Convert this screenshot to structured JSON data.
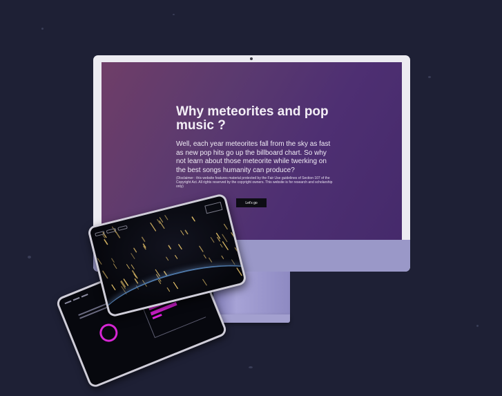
{
  "landing": {
    "title": "Why meteorites and pop music ?",
    "lead": "Well, each year meteorites fall from the sky as fast as new pop hits go up the billboard chart. So why not learn about those meteorite while twerking on the best songs humanity can produce?",
    "disclaimer": "(Disclaimer : this website features material protected by the Fair Use guidelines of Section 107 of the Copyright Act. All rights reserved by the copyright owners. This website is for research and scholarship only)",
    "cta_label": "Let's go"
  },
  "colors": {
    "background": "#1e2035",
    "screen_gradient_start": "#6f3e68",
    "screen_gradient_end": "#452a6b",
    "imac_chin": "#9a98c8",
    "accent_magenta": "#e122de",
    "meteor_gold": "#e8c46a"
  },
  "icons": [
    "camera-icon"
  ]
}
